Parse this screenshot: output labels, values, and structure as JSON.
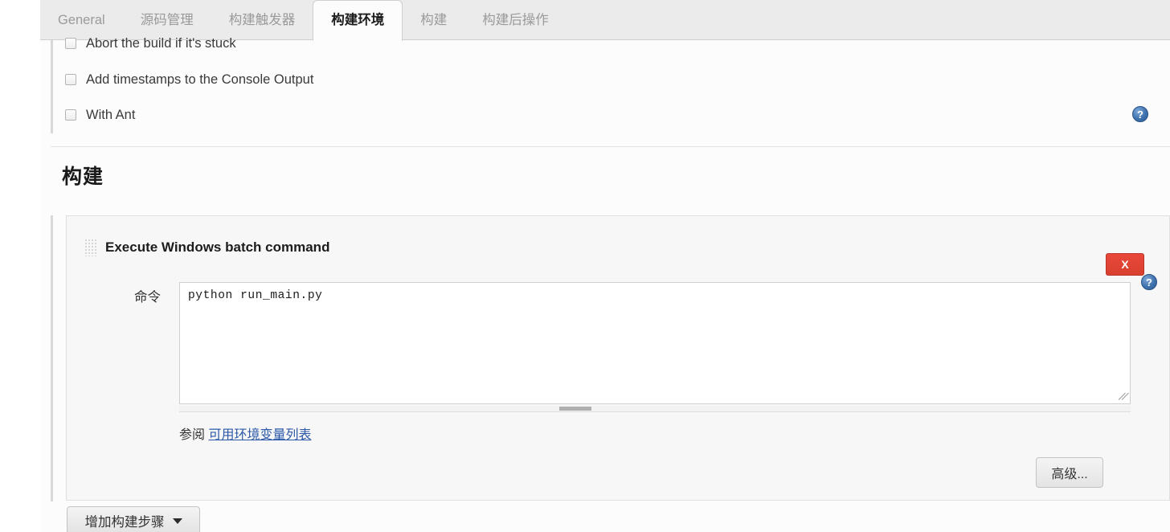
{
  "tabs": [
    {
      "label": "General",
      "active": false
    },
    {
      "label": "源码管理",
      "active": false
    },
    {
      "label": "构建触发器",
      "active": false
    },
    {
      "label": "构建环境",
      "active": true
    },
    {
      "label": "构建",
      "active": false
    },
    {
      "label": "构建后操作",
      "active": false
    }
  ],
  "build_environment": {
    "checkboxes": [
      {
        "label": "Abort the build if it's stuck",
        "checked": false
      },
      {
        "label": "Add timestamps to the Console Output",
        "checked": false
      },
      {
        "label": "With Ant",
        "checked": false
      }
    ],
    "help_icon": "?"
  },
  "build_section": {
    "heading": "构建",
    "step": {
      "title": "Execute Windows batch command",
      "delete_label": "X",
      "help_icon": "?",
      "command_label": "命令",
      "command_value": "python run_main.py",
      "see_also_prefix": "参阅",
      "see_also_link": "可用环境变量列表",
      "advanced_label": "高级..."
    },
    "add_step_label": "增加构建步骤"
  },
  "colors": {
    "tab_strip": "#ebebeb",
    "content_bg": "#fcfcfc",
    "panel_bg": "#f7f7f7",
    "delete_red": "#d8402f",
    "help_blue": "#3f72ae",
    "link_blue": "#2b58a8"
  }
}
